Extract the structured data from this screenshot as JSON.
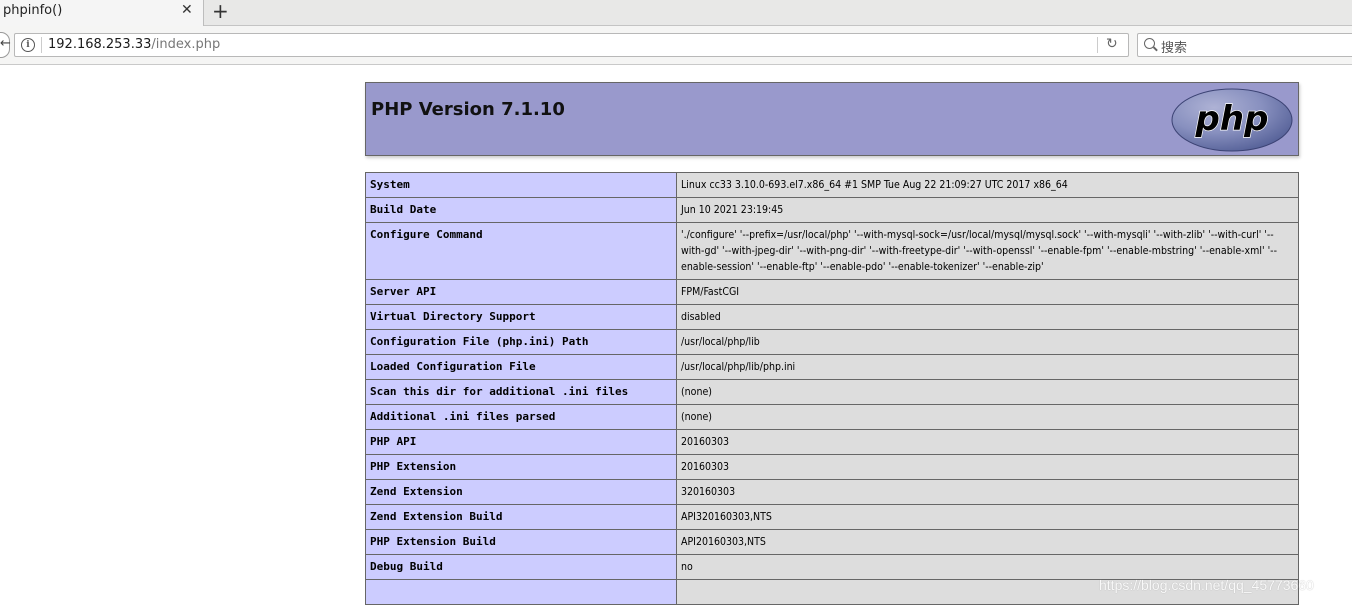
{
  "browser": {
    "tab_title": "phpinfo()",
    "tab_close": "✕",
    "new_tab": "+",
    "url_host": "192.168.253.33",
    "url_path": "/index.php",
    "search_placeholder": "搜索"
  },
  "php": {
    "title": "PHP Version 7.1.10",
    "logo_text": "php"
  },
  "rows": [
    {
      "key": "System",
      "value": "Linux cc33 3.10.0-693.el7.x86_64 #1 SMP Tue Aug 22 21:09:27 UTC 2017 x86_64"
    },
    {
      "key": "Build Date",
      "value": "Jun 10 2021 23:19:45"
    },
    {
      "key": "Configure Command",
      "value": "'./configure' '--prefix=/usr/local/php' '--with-mysql-sock=/usr/local/mysql/mysql.sock' '--with-mysqli' '--with-zlib' '--with-curl' '--with-gd' '--with-jpeg-dir' '--with-png-dir' '--with-freetype-dir' '--with-openssl' '--enable-fpm' '--enable-mbstring' '--enable-xml' '--enable-session' '--enable-ftp' '--enable-pdo' '--enable-tokenizer' '--enable-zip'"
    },
    {
      "key": "Server API",
      "value": "FPM/FastCGI"
    },
    {
      "key": "Virtual Directory Support",
      "value": "disabled"
    },
    {
      "key": "Configuration File (php.ini) Path",
      "value": "/usr/local/php/lib"
    },
    {
      "key": "Loaded Configuration File",
      "value": "/usr/local/php/lib/php.ini"
    },
    {
      "key": "Scan this dir for additional .ini files",
      "value": "(none)"
    },
    {
      "key": "Additional .ini files parsed",
      "value": "(none)"
    },
    {
      "key": "PHP API",
      "value": "20160303"
    },
    {
      "key": "PHP Extension",
      "value": "20160303"
    },
    {
      "key": "Zend Extension",
      "value": "320160303"
    },
    {
      "key": "Zend Extension Build",
      "value": "API320160303,NTS"
    },
    {
      "key": "PHP Extension Build",
      "value": "API20160303,NTS"
    },
    {
      "key": "Debug Build",
      "value": "no"
    },
    {
      "key": "",
      "value": ""
    }
  ],
  "watermark": "https://blog.csdn.net/qq_45773660"
}
